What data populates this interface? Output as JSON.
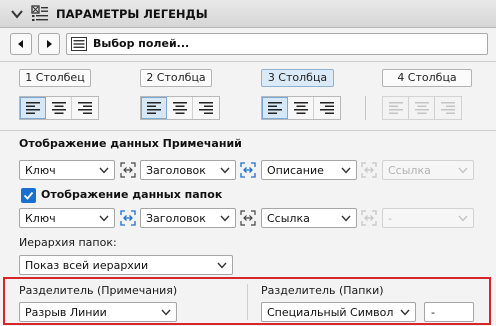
{
  "header": {
    "title": "ПАРАМЕТРЫ ЛЕГЕНДЫ"
  },
  "nav": {
    "field_value": "Выбор полей..."
  },
  "columns": [
    "1 Столбец",
    "2 Столбца",
    "3 Столбца",
    "4 Столбца"
  ],
  "active_column": "3 Столбца",
  "notes": {
    "title": "Отображение данных Примечаний",
    "dropdowns": [
      "Ключ",
      "Заголовок",
      "Описание",
      "Ссылка"
    ]
  },
  "folders": {
    "title": "Отображение данных папок",
    "checked": true,
    "dropdowns": [
      "Ключ",
      "Заголовок",
      "Ссылка",
      "-"
    ]
  },
  "hierarchy": {
    "label": "Иерархия папок:",
    "value": "Показ всей иерархии"
  },
  "separators": {
    "notes_label": "Разделитель (Примечания)",
    "notes_value": "Разрыв Линии",
    "folders_label": "Разделитель (Папки)",
    "folders_value": "Специальный Символ",
    "folders_symbol": "-"
  },
  "colors": {
    "accent": "#1b6fd1",
    "highlight_border": "#d6262b",
    "selected_bg": "#dbeaf7"
  }
}
